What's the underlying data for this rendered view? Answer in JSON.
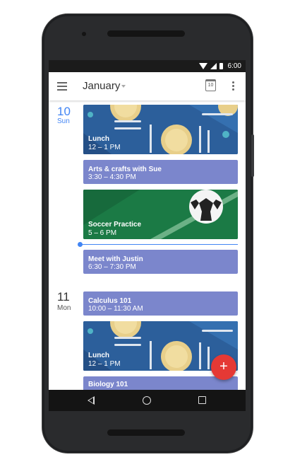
{
  "status_bar": {
    "time": "6:00"
  },
  "app_bar": {
    "month": "January",
    "today_icon_day": "10"
  },
  "days": [
    {
      "number": "10",
      "weekday": "Sun"
    },
    {
      "number": "11",
      "weekday": "Mon"
    }
  ],
  "events": [
    {
      "title": "Lunch",
      "time": "12 – 1 PM"
    },
    {
      "title": "Arts & crafts with Sue",
      "time": "3:30 – 4:30 PM"
    },
    {
      "title": "Soccer Practice",
      "time": "5 – 6 PM"
    },
    {
      "title": "Meet with Justin",
      "time": "6:30 – 7:30 PM"
    },
    {
      "title": "Calculus 101",
      "time": "10:00 – 11:30 AM"
    },
    {
      "title": "Lunch",
      "time": "12 – 1 PM"
    },
    {
      "title": "Biology 101",
      "time": ""
    }
  ],
  "fab": {
    "label": "+"
  },
  "colors": {
    "accent": "#4285f4",
    "event_purple": "#7b86cc",
    "lunch_blue": "#2c5f9b",
    "soccer_green": "#1b7a45",
    "fab_red": "#e53935"
  }
}
